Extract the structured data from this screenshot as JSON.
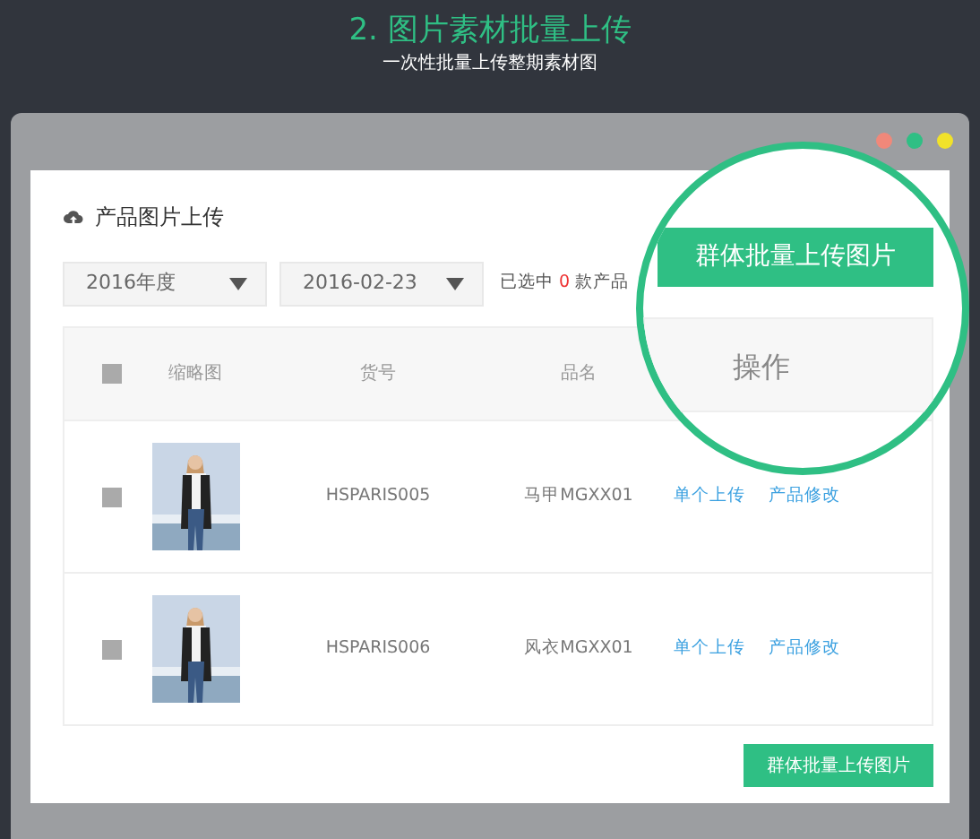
{
  "banner": {
    "title": "2. 图片素材批量上传",
    "subtitle": "一次性批量上传整期素材图"
  },
  "panel": {
    "title": "产品图片上传",
    "filters": [
      {
        "value": "2016年度"
      },
      {
        "value": "2016-02-23"
      }
    ],
    "selection": {
      "prefix": "已选中",
      "count": "0",
      "suffix": "款产品"
    },
    "table": {
      "header_checkbox": {
        "checked": false
      },
      "columns": [
        "缩略图",
        "货号",
        "品名"
      ],
      "rows": [
        {
          "checked": false,
          "thumbnail": {
            "kind": "picture"
          },
          "sku": "HSPARIS005",
          "name": "马甲MGXX01",
          "actions": [
            "单个上传",
            "产品修改"
          ]
        },
        {
          "checked": false,
          "thumbnail": {
            "kind": "picture"
          },
          "sku": "HSPARIS006",
          "name": "风衣MGXX01",
          "actions": [
            "单个上传",
            "产品修改"
          ]
        }
      ]
    },
    "bottom_button": "群体批量上传图片"
  },
  "magnifier": {
    "button": "群体批量上传图片",
    "column_header": "操作"
  }
}
